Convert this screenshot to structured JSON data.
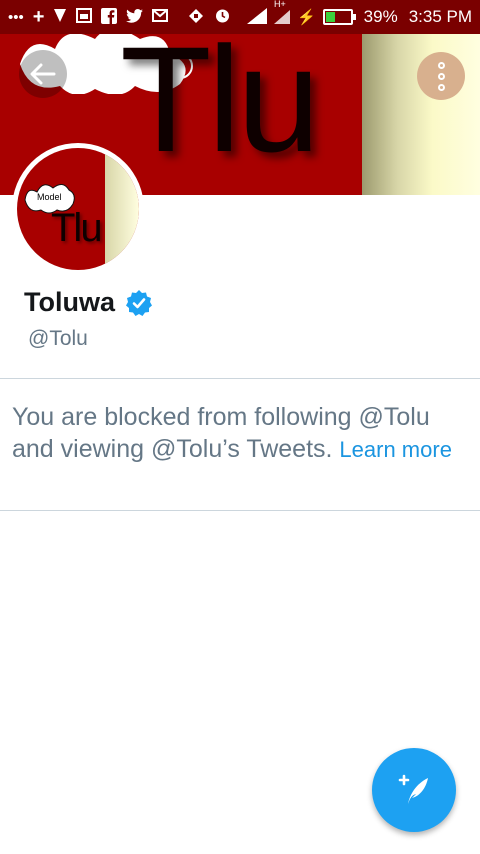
{
  "status_bar": {
    "battery_percent": "39%",
    "time": "3:35 PM",
    "network": "H+",
    "icons": [
      "more-icon",
      "plus-icon",
      "shield-icon",
      "photo-icon",
      "facebook-icon",
      "twitter-icon",
      "gmail-icon",
      "tag-icon",
      "alarm-icon",
      "signal-icon",
      "mobile-data-icon",
      "charging-icon",
      "battery-icon"
    ],
    "bar_color": "#7a0000"
  },
  "header": {
    "banner_text": "Tlu",
    "banner_color": "#a80000",
    "back_icon": "arrow-left-icon",
    "more_icon": "more-vertical-icon"
  },
  "profile": {
    "avatar_label": "Model",
    "avatar_text": "Tlu",
    "name": "Toluwa",
    "verified": true,
    "handle": "@Tolu"
  },
  "blocked_message": {
    "text": "You are blocked from following @Tolu and viewing @Tolu’s Tweets.",
    "link": "Learn more",
    "link_color": "#1b95e0"
  },
  "fab": {
    "icon": "compose-tweet-icon",
    "color": "#1da1f2"
  }
}
